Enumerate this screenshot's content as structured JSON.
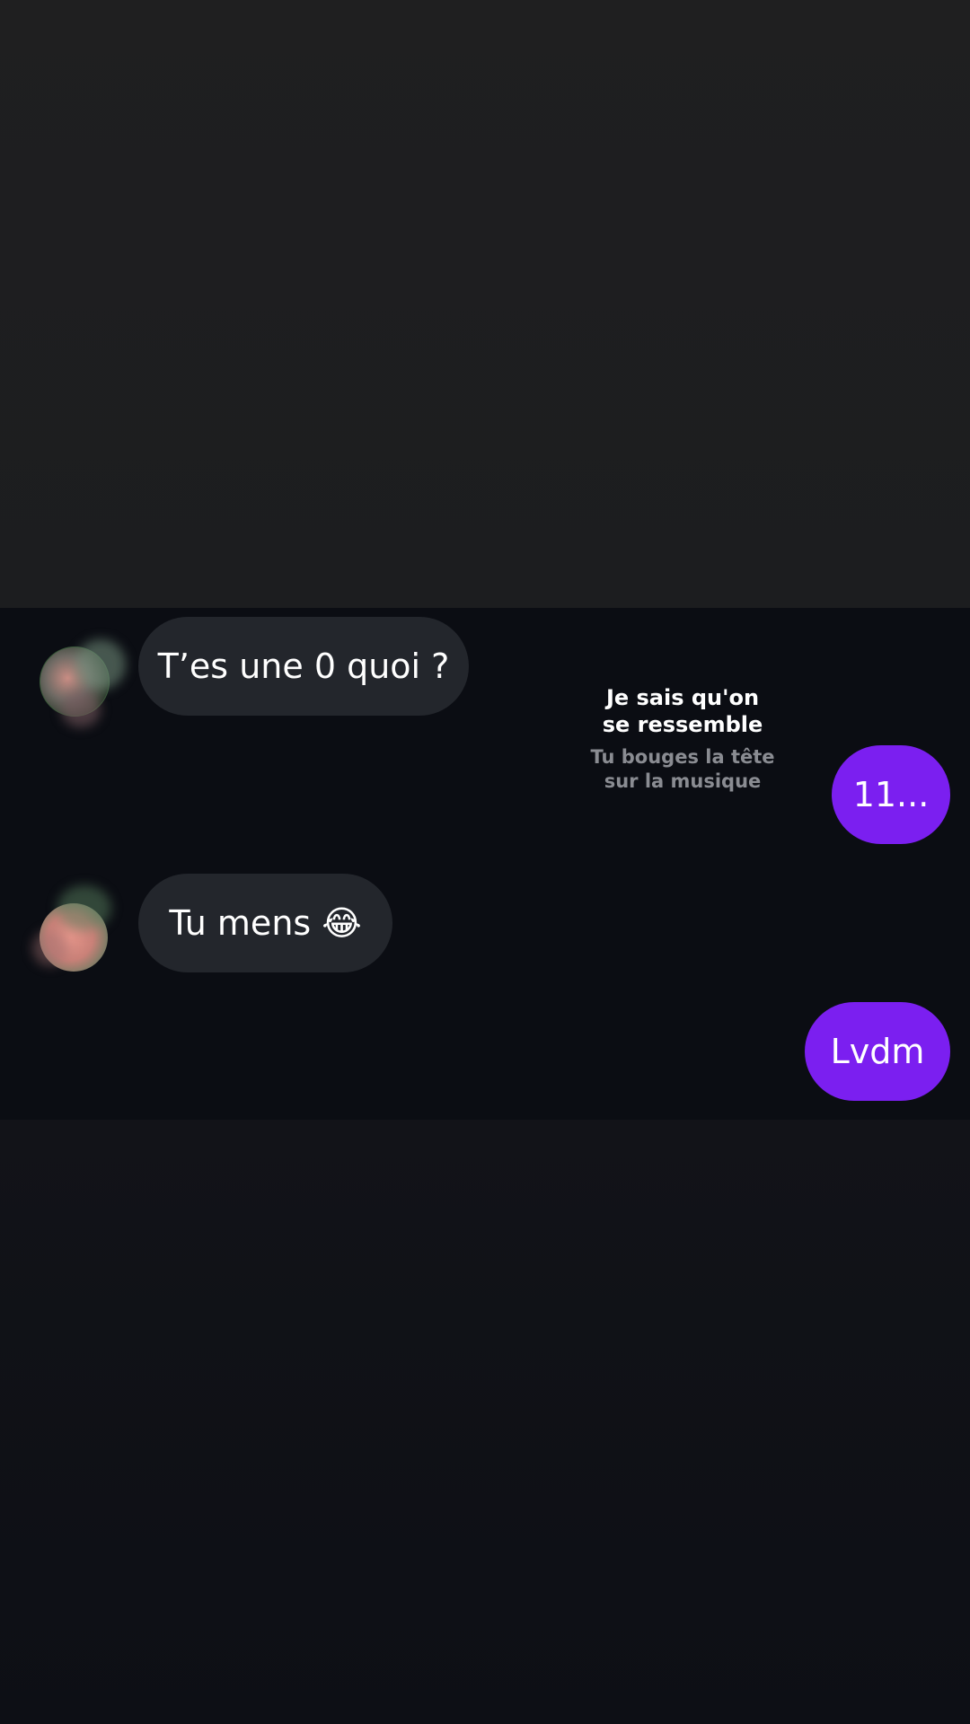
{
  "conversation": {
    "messages": [
      {
        "direction": "incoming",
        "text": "T’es une 0 quoi ?"
      },
      {
        "direction": "outgoing",
        "text": "11..."
      },
      {
        "direction": "incoming",
        "text": "Tu mens 😂"
      },
      {
        "direction": "outgoing",
        "text": "Lvdm"
      }
    ],
    "shared_song": {
      "title": "Je sais qu'on\nse ressemble",
      "subtitle": "Tu bouges la tête\nsur la musique"
    }
  },
  "colors": {
    "incoming_bubble": "#23262c",
    "outgoing_bubble": "#7b1ff0",
    "chat_background": "#0b0d13"
  }
}
